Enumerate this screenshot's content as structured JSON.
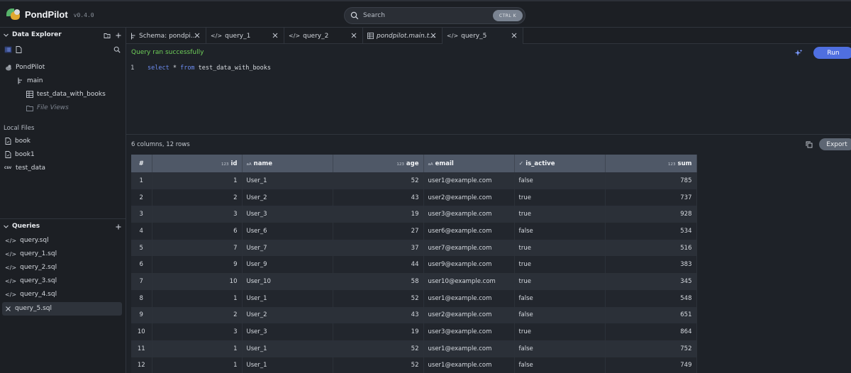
{
  "app": {
    "name": "PondPilot",
    "version": "v0.4.0"
  },
  "search": {
    "placeholder": "Search",
    "shortcut": "CTRL K"
  },
  "sidebar": {
    "explorer_title": "Data Explorer",
    "db_name": "PondPilot",
    "schema_name": "main",
    "table_name": "test_data_with_books",
    "file_views": "File Views",
    "local_files_title": "Local Files",
    "local_files": [
      {
        "name": "book",
        "icon": "file-icon"
      },
      {
        "name": "book1",
        "icon": "file-icon"
      },
      {
        "name": "test_data",
        "icon": "csv-icon"
      }
    ],
    "queries_title": "Queries",
    "queries": [
      "query.sql",
      "query_1.sql",
      "query_2.sql",
      "query_3.sql",
      "query_4.sql",
      "query_5.sql"
    ],
    "active_query_index": 5
  },
  "tabs": [
    {
      "label": "Schema: pondpi...",
      "icon": "schema-icon",
      "italic": false
    },
    {
      "label": "query_1",
      "icon": "code-icon",
      "italic": false
    },
    {
      "label": "query_2",
      "icon": "code-icon",
      "italic": false
    },
    {
      "label": "pondpilot.main.t...",
      "icon": "table-icon",
      "italic": true
    },
    {
      "label": "query_5",
      "icon": "code-icon",
      "italic": false,
      "active": true
    }
  ],
  "editor": {
    "status": "Query ran successfully",
    "run_label": "Run",
    "line_number": "1",
    "code_keyword1": "select",
    "code_star": " * ",
    "code_keyword2": "from",
    "code_table": " test_data_with_books"
  },
  "results": {
    "summary": "6 columns, 12 rows",
    "export_label": "Export",
    "columns": [
      {
        "label": "#",
        "type": ""
      },
      {
        "label": "id",
        "type": "123"
      },
      {
        "label": "name",
        "type": "aA"
      },
      {
        "label": "age",
        "type": "123"
      },
      {
        "label": "email",
        "type": "aA"
      },
      {
        "label": "is_active",
        "type": "✓"
      },
      {
        "label": "sum",
        "type": "123"
      }
    ],
    "rows": [
      [
        "1",
        "1",
        "User_1",
        "52",
        "user1@example.com",
        "false",
        "785"
      ],
      [
        "2",
        "2",
        "User_2",
        "43",
        "user2@example.com",
        "true",
        "737"
      ],
      [
        "3",
        "3",
        "User_3",
        "19",
        "user3@example.com",
        "true",
        "928"
      ],
      [
        "4",
        "6",
        "User_6",
        "27",
        "user6@example.com",
        "false",
        "534"
      ],
      [
        "5",
        "7",
        "User_7",
        "37",
        "user7@example.com",
        "true",
        "516"
      ],
      [
        "6",
        "9",
        "User_9",
        "44",
        "user9@example.com",
        "true",
        "383"
      ],
      [
        "7",
        "10",
        "User_10",
        "58",
        "user10@example.com",
        "true",
        "345"
      ],
      [
        "8",
        "1",
        "User_1",
        "52",
        "user1@example.com",
        "false",
        "548"
      ],
      [
        "9",
        "2",
        "User_2",
        "43",
        "user2@example.com",
        "false",
        "651"
      ],
      [
        "10",
        "3",
        "User_3",
        "19",
        "user3@example.com",
        "true",
        "864"
      ],
      [
        "11",
        "1",
        "User_1",
        "52",
        "user1@example.com",
        "false",
        "752"
      ],
      [
        "12",
        "1",
        "User_1",
        "52",
        "user1@example.com",
        "false",
        "749"
      ]
    ]
  }
}
